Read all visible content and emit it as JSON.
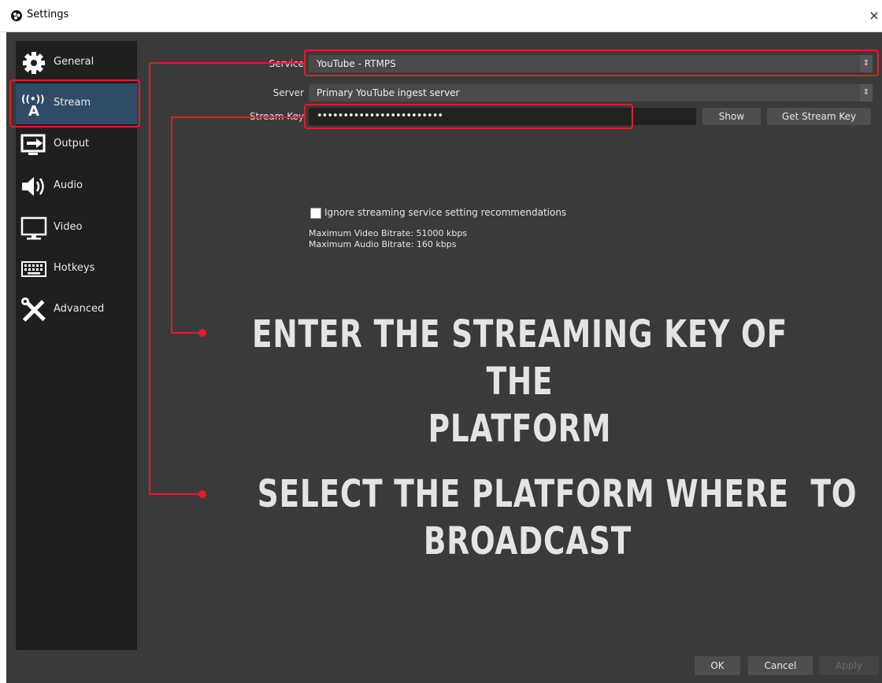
{
  "window": {
    "title": "Settings",
    "close_label": "×"
  },
  "sidebar": {
    "items": [
      {
        "label": "General",
        "icon": "gear-icon"
      },
      {
        "label": "Stream",
        "icon": "broadcast-antenna-icon",
        "selected": true
      },
      {
        "label": "Output",
        "icon": "output-monitor-icon"
      },
      {
        "label": "Audio",
        "icon": "speaker-icon"
      },
      {
        "label": "Video",
        "icon": "monitor-icon"
      },
      {
        "label": "Hotkeys",
        "icon": "keyboard-icon"
      },
      {
        "label": "Advanced",
        "icon": "tools-icon"
      }
    ]
  },
  "stream": {
    "service_label": "Service",
    "service_value": "YouTube - RTMPS",
    "server_label": "Server",
    "server_value": "Primary YouTube ingest server",
    "key_label": "Stream Key",
    "key_value": "••••••••••••••••••••••••",
    "show_button": "Show",
    "get_key_button": "Get Stream Key",
    "ignore_label": "Ignore streaming service setting recommendations",
    "max_video": "Maximum Video Bitrate: 51000 kbps",
    "max_audio": "Maximum Audio Bitrate: 160 kbps"
  },
  "annotations": {
    "key_text_line1": "ENTER THE STREAMING KEY OF THE",
    "key_text_line2": "PLATFORM",
    "platform_text_line1": "SELECT THE PLATFORM WHERE  TO",
    "platform_text_line2": "BROADCAST",
    "highlight_color": "#e21c2a"
  },
  "footer": {
    "ok": "OK",
    "cancel": "Cancel",
    "apply": "Apply"
  }
}
